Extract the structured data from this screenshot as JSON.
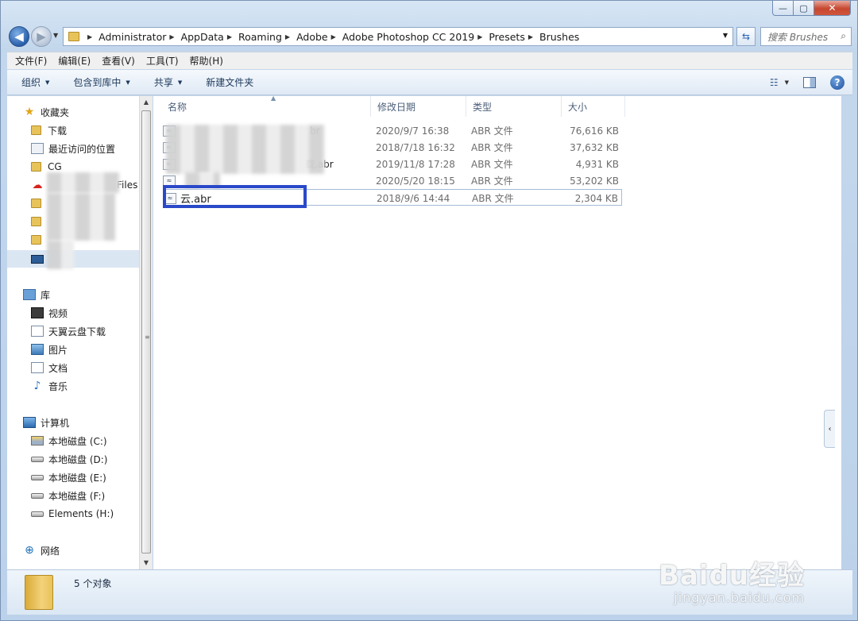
{
  "caption": {
    "minimize": "—",
    "maximize": "▢",
    "close": "✕"
  },
  "address": {
    "crumbs": [
      "Administrator",
      "AppData",
      "Roaming",
      "Adobe",
      "Adobe Photoshop CC 2019",
      "Presets",
      "Brushes"
    ],
    "search_placeholder": "搜索 Brushes"
  },
  "menu": [
    "文件(F)",
    "编辑(E)",
    "查看(V)",
    "工具(T)",
    "帮助(H)"
  ],
  "commands": [
    "组织",
    "包含到库中",
    "共享",
    "新建文件夹"
  ],
  "nav": {
    "favorites": "收藏夹",
    "fav_items": [
      "下载",
      "最近访问的位置",
      "CG",
      "Files"
    ],
    "libraries": "库",
    "lib_items": [
      "视频",
      "天翼云盘下载",
      "图片",
      "文档",
      "音乐"
    ],
    "computer": "计算机",
    "drives": [
      "本地磁盘 (C:)",
      "本地磁盘 (D:)",
      "本地磁盘 (E:)",
      "本地磁盘 (F:)",
      "Elements (H:)"
    ],
    "network": "网络"
  },
  "columns": [
    "名称",
    "修改日期",
    "类型",
    "大小"
  ],
  "files": [
    {
      "name": "br",
      "date": "2020/9/7 16:38",
      "type": "ABR 文件",
      "size": "76,616 KB"
    },
    {
      "name": "",
      "date": "2018/7/18 16:32",
      "type": "ABR 文件",
      "size": "37,632 KB"
    },
    {
      "name": "载.abr",
      "date": "2019/11/8 17:28",
      "type": "ABR 文件",
      "size": "4,931 KB"
    },
    {
      "name": "",
      "date": "2020/5/20 18:15",
      "type": "ABR 文件",
      "size": "53,202 KB"
    },
    {
      "name": "云.abr",
      "date": "2018/9/6 14:44",
      "type": "ABR 文件",
      "size": "2,304 KB"
    }
  ],
  "status": {
    "count": "5 个对象"
  },
  "watermark": {
    "logo": "Baidu经验",
    "url": "jingyan.baidu.com"
  },
  "colors": {
    "highlight": "#2a49c9",
    "window_frame": "#c3d7ec",
    "selection": "#dbe6f3"
  }
}
